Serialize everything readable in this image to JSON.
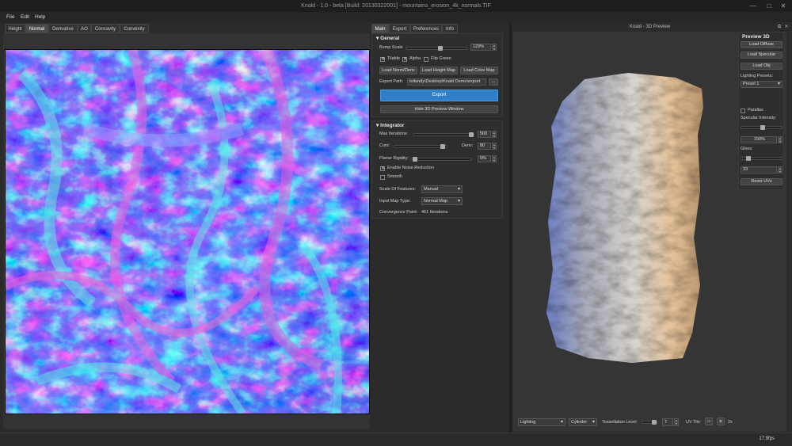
{
  "window": {
    "title": "Knald - 1.0 - beta [Build: 20130322001] - mountains_erosion_4k_normals.TIF"
  },
  "menu": {
    "items": [
      "File",
      "Edit",
      "Help"
    ]
  },
  "view_tabs": [
    "Height",
    "Normal",
    "Derivative",
    "AO",
    "Concavity",
    "Convexity"
  ],
  "panel_tabs": [
    "Main",
    "Export",
    "Preferences",
    "Info"
  ],
  "general": {
    "header": "General",
    "bump_scale_label": "Bump Scale",
    "bump_scale_value": "129%",
    "tileable": "Tilable",
    "alpha": "Alpha",
    "flip_green": "Flip Green",
    "load_norm": "Load Norm/Deriv",
    "load_height": "Load Height Map",
    "load_color": "Load Color Map",
    "export_path_label": "Export Path:",
    "export_path_value": "tollandy\\Desktop\\Knald Demo\\export",
    "browse": "...",
    "export_button": "Export",
    "hide_preview": "Hide 3D Preview Window"
  },
  "integrator": {
    "header": "Integrator",
    "max_iter_label": "Max Iterations:",
    "max_iter_value": "500",
    "cont_label": "Cont:",
    "deriv_label": "Deriv:",
    "deriv_value": "80",
    "planar_label": "Planar Rigidity:",
    "planar_value": "0%",
    "noise": "Enable Noise Reduction",
    "smooth": "Smooth",
    "scale_label": "Scale Of Features:",
    "scale_value": "Manual",
    "input_label": "Input Map Type:",
    "input_value": "Normal Map",
    "convergence_label": "Convergence Point:",
    "convergence_value": "461 Iterations"
  },
  "preview": {
    "title": "Knald - 3D Preview",
    "header": "Preview 3D",
    "load_diffuse": "Load Diffuse",
    "load_specular": "Load Specular",
    "load_obj": "Load Obj",
    "lighting_presets_label": "Lighting Presets:",
    "preset_value": "Preset 1",
    "parallax": "Parallax",
    "specular_label": "Specular Intensity:",
    "specular_value": "150%",
    "gloss_label": "Gloss:",
    "gloss_value": "33",
    "reset_uvs": "Reset UVs"
  },
  "bottom": {
    "mode": "Lighting",
    "shape": "Cylinder",
    "tess_label": "Tessellation Level:",
    "tess_value": "7",
    "uv_label": "UV Tile:",
    "uv_value": "2x"
  },
  "status": {
    "fps": "17.9fps"
  }
}
